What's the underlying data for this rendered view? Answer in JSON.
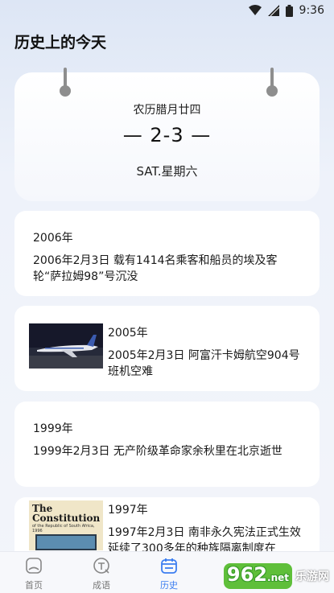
{
  "status_bar": {
    "time": "9:36"
  },
  "header": {
    "title": "历史上的今天"
  },
  "calendar": {
    "lunar_date": "农历腊月廿四",
    "date": "— 2-3 —",
    "weekday": "SAT.星期六"
  },
  "events": [
    {
      "year": "2006年",
      "title": "2006年2月3日 载有1414名乘客和船员的埃及客轮“萨拉姆98”号沉没",
      "has_image": false
    },
    {
      "year": "2005年",
      "title": "2005年2月3日 阿富汗卡姆航空904号班机空难",
      "has_image": true,
      "image": "airplane-photo"
    },
    {
      "year": "1999年",
      "title": "1999年2月3日 无产阶级革命家余秋里在北京逝世",
      "has_image": false
    },
    {
      "year": "1997年",
      "title": "1997年2月3日 南非永久宪法正式生效 延续了300多年的种族隔离制度在",
      "has_image": true,
      "image": "constitution-book-photo",
      "image_text": {
        "heading": "The Constitution",
        "sub": "of the Republic of South Africa, 1996"
      }
    }
  ],
  "bottom_nav": [
    {
      "label": "首页",
      "icon": "home-icon",
      "active": false
    },
    {
      "label": "成语",
      "icon": "idiom-icon",
      "active": false
    },
    {
      "label": "历史",
      "icon": "calendar-icon",
      "active": true
    }
  ],
  "watermark": {
    "number": "962",
    "suffix": ".net",
    "text": "乐游网"
  },
  "colors": {
    "accent": "#3b7df0",
    "nav_inactive": "#777777"
  }
}
